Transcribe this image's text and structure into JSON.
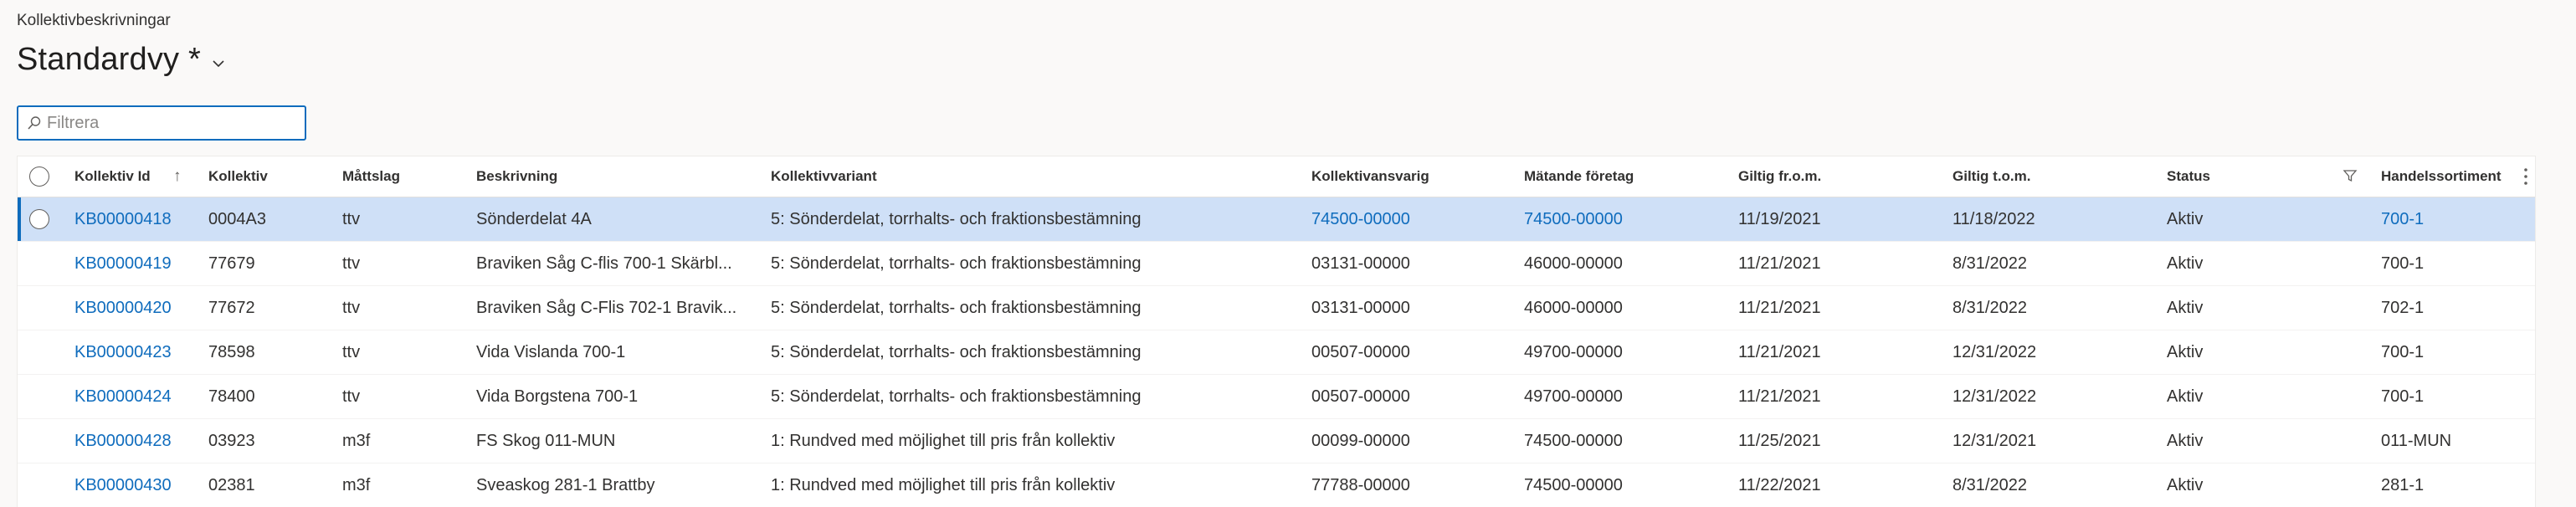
{
  "breadcrumb": "Kollektivbeskrivningar",
  "view": {
    "title": "Standardvy *"
  },
  "filter": {
    "placeholder": "Filtrera",
    "value": ""
  },
  "columns": {
    "kollektiv_id": "Kollektiv Id",
    "kollektiv": "Kollektiv",
    "mattslag": "Måttslag",
    "beskrivning": "Beskrivning",
    "kollektivvariant": "Kollektivvariant",
    "kollektivansvarig": "Kollektivansvarig",
    "matande_foretag": "Mätande företag",
    "giltig_from": "Giltig fr.o.m.",
    "giltig_tom": "Giltig t.o.m.",
    "status": "Status",
    "handelssortiment": "Handelssortiment"
  },
  "rows": [
    {
      "id": "KB00000418",
      "kollektiv": "0004A3",
      "mattslag": "ttv",
      "beskrivning": "Sönderdelat 4A",
      "variant": "5: Sönderdelat, torrhalts- och fraktionsbestämning",
      "ansvarig": "74500-00000",
      "matande": "74500-00000",
      "from": "11/19/2021",
      "tom": "11/18/2022",
      "status": "Aktiv",
      "sortiment": "700-1"
    },
    {
      "id": "KB00000419",
      "kollektiv": "77679",
      "mattslag": "ttv",
      "beskrivning": "Braviken Såg C-flis 700-1 Skärbl...",
      "variant": "5: Sönderdelat, torrhalts- och fraktionsbestämning",
      "ansvarig": "03131-00000",
      "matande": "46000-00000",
      "from": "11/21/2021",
      "tom": "8/31/2022",
      "status": "Aktiv",
      "sortiment": "700-1"
    },
    {
      "id": "KB00000420",
      "kollektiv": "77672",
      "mattslag": "ttv",
      "beskrivning": "Braviken Såg C-Flis 702-1 Bravik...",
      "variant": "5: Sönderdelat, torrhalts- och fraktionsbestämning",
      "ansvarig": "03131-00000",
      "matande": "46000-00000",
      "from": "11/21/2021",
      "tom": "8/31/2022",
      "status": "Aktiv",
      "sortiment": "702-1"
    },
    {
      "id": "KB00000423",
      "kollektiv": "78598",
      "mattslag": "ttv",
      "beskrivning": "Vida Vislanda 700-1",
      "variant": "5: Sönderdelat, torrhalts- och fraktionsbestämning",
      "ansvarig": "00507-00000",
      "matande": "49700-00000",
      "from": "11/21/2021",
      "tom": "12/31/2022",
      "status": "Aktiv",
      "sortiment": "700-1"
    },
    {
      "id": "KB00000424",
      "kollektiv": "78400",
      "mattslag": "ttv",
      "beskrivning": "Vida Borgstena 700-1",
      "variant": "5: Sönderdelat, torrhalts- och fraktionsbestämning",
      "ansvarig": "00507-00000",
      "matande": "49700-00000",
      "from": "11/21/2021",
      "tom": "12/31/2022",
      "status": "Aktiv",
      "sortiment": "700-1"
    },
    {
      "id": "KB00000428",
      "kollektiv": "03923",
      "mattslag": "m3f",
      "beskrivning": "FS Skog 011-MUN",
      "variant": "1: Rundved med möjlighet till pris från kollektiv",
      "ansvarig": "00099-00000",
      "matande": "74500-00000",
      "from": "11/25/2021",
      "tom": "12/31/2021",
      "status": "Aktiv",
      "sortiment": "011-MUN"
    },
    {
      "id": "KB00000430",
      "kollektiv": "02381",
      "mattslag": "m3f",
      "beskrivning": "Sveaskog 281-1 Brattby",
      "variant": "1: Rundved med möjlighet till pris från kollektiv",
      "ansvarig": "77788-00000",
      "matande": "74500-00000",
      "from": "11/22/2021",
      "tom": "8/31/2022",
      "status": "Aktiv",
      "sortiment": "281-1"
    }
  ],
  "selected_row_index": 0,
  "colors": {
    "accent": "#0f6cbd",
    "selected_row": "#cfe0f7",
    "background": "#faf9f8"
  },
  "icons": {
    "title_dropdown": "chevron-down-icon",
    "filter": "search-icon",
    "sort": "sort-ascending-icon",
    "column_filter": "filter-funnel-icon",
    "column_menu": "more-vertical-icon",
    "row_select": "radio-icon"
  }
}
